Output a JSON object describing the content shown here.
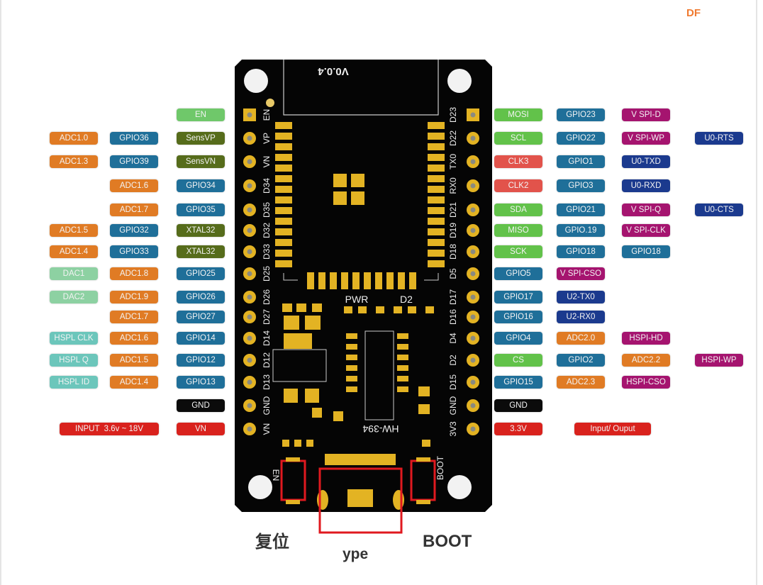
{
  "logo": "DF",
  "colors": {
    "orange": "#e07b24",
    "blue": "#1f6f99",
    "olive": "#566c1b",
    "green": "#62c24a",
    "lightgreen": "#6fc86a",
    "dac": "#8dd1a2",
    "teal": "#6cc6bb",
    "red": "#e2534b",
    "power": "#d9221d",
    "magenta": "#a5146f",
    "navy": "#1b3a8e",
    "black": "#0b0b0b"
  },
  "board": {
    "version": "V0.0.4",
    "model": "HW-394",
    "pwr_label": "PWR",
    "d2_label": "D2",
    "en_button_label": "EN",
    "boot_button_label": "BOOT",
    "left_pins": [
      "EN",
      "VP",
      "VN",
      "D34",
      "D35",
      "D32",
      "D33",
      "D25",
      "D26",
      "D27",
      "D14",
      "D12",
      "D13",
      "GND",
      "VN"
    ],
    "right_pins": [
      "D23",
      "D22",
      "TX0",
      "RX0",
      "D21",
      "D19",
      "D18",
      "D5",
      "D17",
      "D16",
      "D4",
      "D2",
      "D15",
      "GND",
      "3V3"
    ]
  },
  "captions": {
    "reset": "复位",
    "usb": "ype",
    "boot": "BOOT"
  },
  "left_rows": [
    [
      null,
      null,
      {
        "text": "EN",
        "color": "lightgreen"
      }
    ],
    [
      {
        "text": "ADC1.0",
        "color": "orange"
      },
      {
        "text": "GPIO36",
        "color": "blue"
      },
      {
        "text": "SensVP",
        "color": "olive"
      }
    ],
    [
      {
        "text": "ADC1.3",
        "color": "orange"
      },
      {
        "text": "GPIO39",
        "color": "blue"
      },
      {
        "text": "SensVN",
        "color": "olive"
      }
    ],
    [
      null,
      {
        "text": "ADC1.6",
        "color": "orange"
      },
      {
        "text": "GPIO34",
        "color": "blue"
      }
    ],
    [
      null,
      {
        "text": "ADC1.7",
        "color": "orange"
      },
      {
        "text": "GPIO35",
        "color": "blue"
      }
    ],
    [
      {
        "text": "ADC1.5",
        "color": "orange"
      },
      {
        "text": "GPIO32",
        "color": "blue"
      },
      {
        "text": "XTAL32",
        "color": "olive"
      }
    ],
    [
      {
        "text": "ADC1.4",
        "color": "orange"
      },
      {
        "text": "GPIO33",
        "color": "blue"
      },
      {
        "text": "XTAL32",
        "color": "olive"
      }
    ],
    [
      {
        "text": "DAC1",
        "color": "dac"
      },
      {
        "text": "ADC1.8",
        "color": "orange"
      },
      {
        "text": "GPIO25",
        "color": "blue"
      }
    ],
    [
      {
        "text": "DAC2",
        "color": "dac"
      },
      {
        "text": "ADC1.9",
        "color": "orange"
      },
      {
        "text": "GPIO26",
        "color": "blue"
      }
    ],
    [
      null,
      {
        "text": "ADC1.7",
        "color": "orange"
      },
      {
        "text": "GPIO27",
        "color": "blue"
      }
    ],
    [
      {
        "text": "HSPL CLK",
        "color": "teal"
      },
      {
        "text": "ADC1.6",
        "color": "orange"
      },
      {
        "text": "GPIO14",
        "color": "blue"
      }
    ],
    [
      {
        "text": "HSPL Q",
        "color": "teal"
      },
      {
        "text": "ADC1.5",
        "color": "orange"
      },
      {
        "text": "GPIO12",
        "color": "blue"
      }
    ],
    [
      {
        "text": "HSPL ID",
        "color": "teal"
      },
      {
        "text": "ADC1.4",
        "color": "orange"
      },
      {
        "text": "GPIO13",
        "color": "blue"
      }
    ],
    [
      null,
      null,
      {
        "text": "GND",
        "color": "black"
      }
    ],
    [
      {
        "text": "INPUT  3.6v ~ 18V",
        "color": "power"
      },
      null,
      {
        "text": "VN",
        "color": "power"
      }
    ]
  ],
  "right_rows": [
    [
      {
        "text": "MOSI",
        "color": "green"
      },
      {
        "text": "GPIO23",
        "color": "blue"
      },
      {
        "text": "V SPI-D",
        "color": "magenta"
      },
      null
    ],
    [
      {
        "text": "SCL",
        "color": "green"
      },
      {
        "text": "GPIO22",
        "color": "blue"
      },
      {
        "text": "V SPI-WP",
        "color": "magenta"
      },
      {
        "text": "U0-RTS",
        "color": "navy"
      }
    ],
    [
      {
        "text": "CLK3",
        "color": "red"
      },
      {
        "text": "GPIO1",
        "color": "blue"
      },
      {
        "text": "U0-TXD",
        "color": "navy"
      },
      null
    ],
    [
      {
        "text": "CLK2",
        "color": "red"
      },
      {
        "text": "GPIO3",
        "color": "blue"
      },
      {
        "text": "U0-RXD",
        "color": "navy"
      },
      null
    ],
    [
      {
        "text": "SDA",
        "color": "green"
      },
      {
        "text": "GPIO21",
        "color": "blue"
      },
      {
        "text": "V SPI-Q",
        "color": "magenta"
      },
      {
        "text": "U0-CTS",
        "color": "navy"
      }
    ],
    [
      {
        "text": "MISO",
        "color": "green"
      },
      {
        "text": "GPIO.19",
        "color": "blue"
      },
      {
        "text": "V SPI-CLK",
        "color": "magenta"
      },
      null
    ],
    [
      {
        "text": "SCK",
        "color": "green"
      },
      {
        "text": "GPIO18",
        "color": "blue"
      },
      {
        "text": "GPIO18",
        "color": "blue"
      },
      null
    ],
    [
      {
        "text": "GPIO5",
        "color": "blue"
      },
      {
        "text": "V SPI-CSO",
        "color": "magenta"
      },
      null,
      null
    ],
    [
      {
        "text": "GPIO17",
        "color": "blue"
      },
      {
        "text": "U2-TX0",
        "color": "navy"
      },
      null,
      null
    ],
    [
      {
        "text": "GPIO16",
        "color": "blue"
      },
      {
        "text": "U2-RX0",
        "color": "navy"
      },
      null,
      null
    ],
    [
      {
        "text": "GPIO4",
        "color": "blue"
      },
      {
        "text": "ADC2.0",
        "color": "orange"
      },
      {
        "text": "HSPI-HD",
        "color": "magenta"
      },
      null
    ],
    [
      {
        "text": "CS",
        "color": "green"
      },
      {
        "text": "GPIO2",
        "color": "blue"
      },
      {
        "text": "ADC2.2",
        "color": "orange"
      },
      {
        "text": "HSPI-WP",
        "color": "magenta"
      }
    ],
    [
      {
        "text": "GPIO15",
        "color": "blue"
      },
      {
        "text": "ADC2.3",
        "color": "orange"
      },
      {
        "text": "HSPI-CSO",
        "color": "magenta"
      },
      null
    ],
    [
      {
        "text": "GND",
        "color": "black"
      },
      null,
      null,
      null
    ],
    [
      {
        "text": "3.3V",
        "color": "power"
      },
      {
        "text": "Input/ Ouput",
        "color": "power"
      },
      null,
      null
    ]
  ]
}
